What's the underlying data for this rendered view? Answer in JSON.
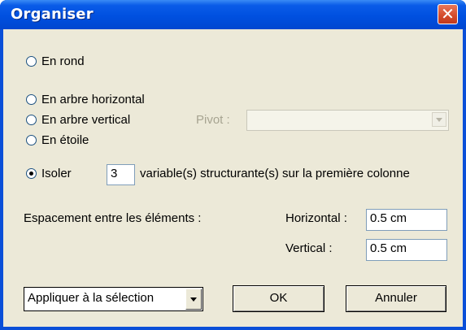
{
  "window": {
    "title": "Organiser",
    "close_glyph": "✕"
  },
  "layout_options": {
    "circle_label": "En rond",
    "horizontal_tree_label": "En arbre horizontal",
    "vertical_tree_label": "En arbre vertical",
    "star_label": "En étoile",
    "isolate_label": "Isoler",
    "selected": "isolate"
  },
  "pivot": {
    "label": "Pivot :",
    "value": "",
    "disabled": true
  },
  "isolate": {
    "count": "3",
    "suffix": "variable(s) structurante(s) sur la première colonne"
  },
  "spacing": {
    "label": "Espacement entre les éléments :",
    "horizontal_label": "Horizontal :",
    "horizontal_value": "0.5 cm",
    "vertical_label": "Vertical :",
    "vertical_value": "0.5 cm"
  },
  "apply_select": {
    "value": "Appliquer à la sélection"
  },
  "buttons": {
    "ok": "OK",
    "cancel": "Annuler"
  }
}
